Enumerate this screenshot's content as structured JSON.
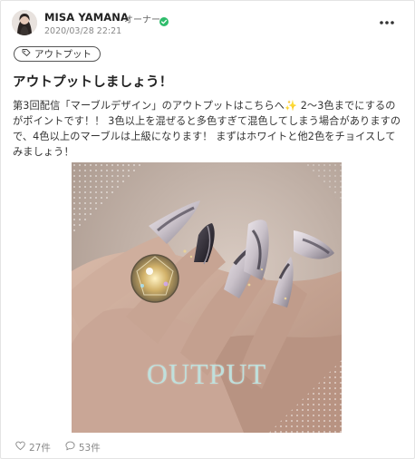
{
  "post": {
    "author": "MISA YAMANA",
    "role": "オーナー",
    "timestamp": "2020/03/28 22:21",
    "tag": "アウトプット",
    "title": "アウトプットしましょう！",
    "body": "第3回配信「マーブルデザイン」のアウトプットはこちらへ✨ 2〜3色までにするのがポイントです！！ 3色以上を混ぜると多色すぎて混色してしまう場合がありますので、4色以上のマーブルは上級になります！ まずはホワイトと他2色をチョイスしてみましょう！",
    "image_caption": "OUTPUT"
  },
  "stats": {
    "likes": "27件",
    "comments": "53件"
  },
  "icons": {
    "more": "more-options-icon",
    "verified": "verified-badge-icon",
    "tag": "tag-icon",
    "like": "heart-icon",
    "comment": "comment-icon"
  },
  "colors": {
    "verified": "#2ebc6b",
    "caption": "#bfe0dc",
    "muted": "#888888"
  }
}
